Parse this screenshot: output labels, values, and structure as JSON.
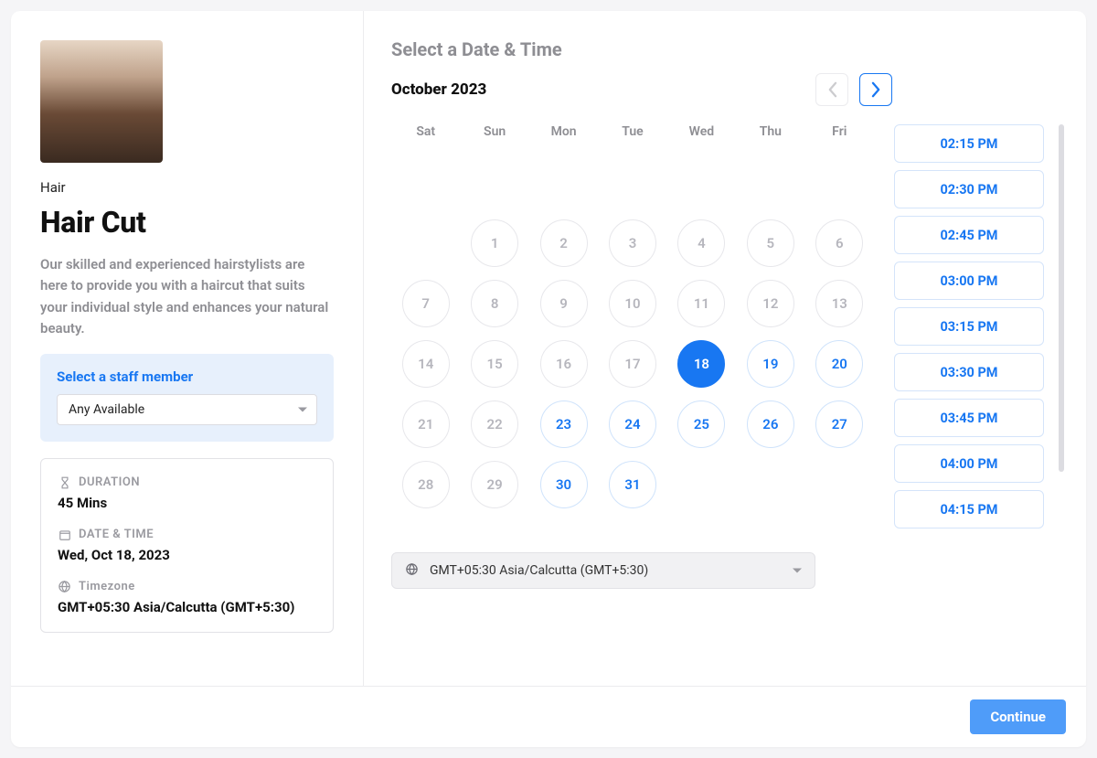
{
  "sidebar": {
    "category": "Hair",
    "title": "Hair Cut",
    "description": "Our skilled and experienced hairstylists are here to provide you with a haircut that suits your individual style and enhances your natural beauty.",
    "staff": {
      "label": "Select a staff member",
      "selected": "Any Available"
    },
    "info": {
      "duration_label": "DURATION",
      "duration_value": "45 Mins",
      "dt_label": "DATE & TIME",
      "dt_value": "Wed, Oct 18, 2023",
      "tz_label": "Timezone",
      "tz_value": "GMT+05:30 Asia/Calcutta (GMT+5:30)"
    }
  },
  "main": {
    "header": "Select a Date & Time",
    "month": "October 2023",
    "weekdays": [
      "Sat",
      "Sun",
      "Mon",
      "Tue",
      "Wed",
      "Thu",
      "Fri"
    ],
    "days": [
      {
        "d": "",
        "t": "empty"
      },
      {
        "d": "",
        "t": "empty"
      },
      {
        "d": "",
        "t": "empty"
      },
      {
        "d": "",
        "t": "empty"
      },
      {
        "d": "",
        "t": "empty"
      },
      {
        "d": "",
        "t": "empty"
      },
      {
        "d": "",
        "t": "empty"
      },
      {
        "d": "",
        "t": "empty"
      },
      {
        "d": "1",
        "t": "past"
      },
      {
        "d": "2",
        "t": "past"
      },
      {
        "d": "3",
        "t": "past"
      },
      {
        "d": "4",
        "t": "past"
      },
      {
        "d": "5",
        "t": "past"
      },
      {
        "d": "6",
        "t": "past"
      },
      {
        "d": "7",
        "t": "past"
      },
      {
        "d": "8",
        "t": "past"
      },
      {
        "d": "9",
        "t": "past"
      },
      {
        "d": "10",
        "t": "past"
      },
      {
        "d": "11",
        "t": "past"
      },
      {
        "d": "12",
        "t": "past"
      },
      {
        "d": "13",
        "t": "past"
      },
      {
        "d": "14",
        "t": "past"
      },
      {
        "d": "15",
        "t": "past"
      },
      {
        "d": "16",
        "t": "past"
      },
      {
        "d": "17",
        "t": "past"
      },
      {
        "d": "18",
        "t": "selected"
      },
      {
        "d": "19",
        "t": "available"
      },
      {
        "d": "20",
        "t": "available"
      },
      {
        "d": "21",
        "t": "past"
      },
      {
        "d": "22",
        "t": "past"
      },
      {
        "d": "23",
        "t": "available"
      },
      {
        "d": "24",
        "t": "available"
      },
      {
        "d": "25",
        "t": "available"
      },
      {
        "d": "26",
        "t": "available"
      },
      {
        "d": "27",
        "t": "available"
      },
      {
        "d": "28",
        "t": "past"
      },
      {
        "d": "29",
        "t": "past"
      },
      {
        "d": "30",
        "t": "available"
      },
      {
        "d": "31",
        "t": "available"
      },
      {
        "d": "",
        "t": "empty"
      },
      {
        "d": "",
        "t": "empty"
      },
      {
        "d": "",
        "t": "empty"
      }
    ],
    "nav": {
      "prev_enabled": false,
      "next_enabled": true
    },
    "times": [
      "02:15 PM",
      "02:30 PM",
      "02:45 PM",
      "03:00 PM",
      "03:15 PM",
      "03:30 PM",
      "03:45 PM",
      "04:00 PM",
      "04:15 PM"
    ],
    "timezone_selected": "GMT+05:30 Asia/Calcutta (GMT+5:30)"
  },
  "footer": {
    "continue_label": "Continue"
  }
}
